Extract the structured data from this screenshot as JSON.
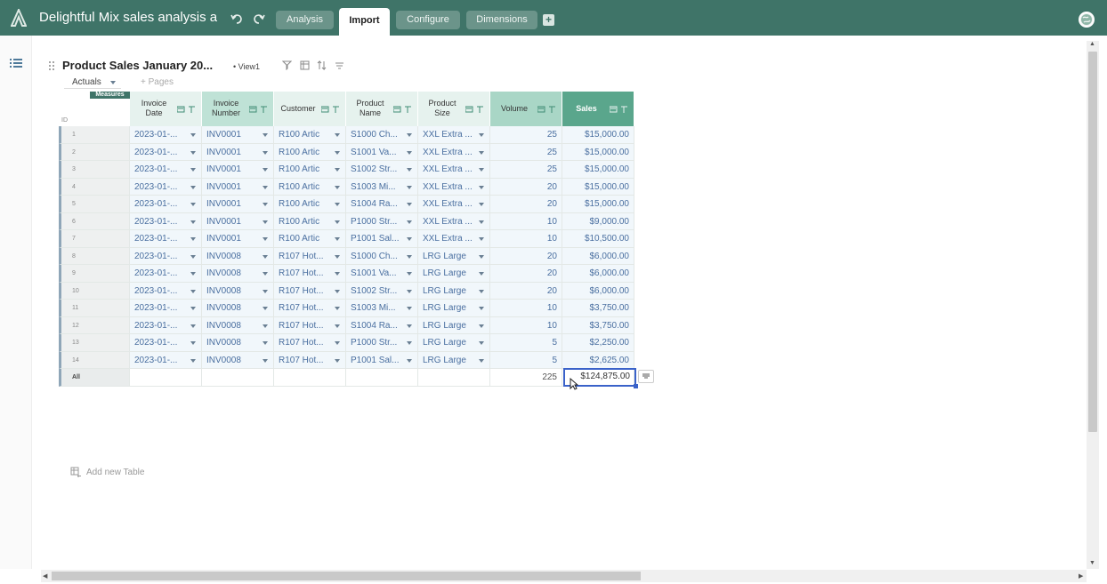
{
  "app": {
    "title": "Delightful Mix sales analysis a",
    "tabs": [
      {
        "label": "Analysis",
        "active": false
      },
      {
        "label": "Import",
        "active": true
      },
      {
        "label": "Configure",
        "active": false
      },
      {
        "label": "Dimensions",
        "active": false
      }
    ],
    "add_tab_label": "+"
  },
  "table": {
    "title": "Product Sales January 20...",
    "view_label": "View1",
    "scenario": "Actuals",
    "pages_label": "+ Pages",
    "measures_badge": "Measures",
    "id_header": "ID",
    "columns": [
      {
        "label_1": "Invoice",
        "label_2": "Date",
        "kind": "attr"
      },
      {
        "label_1": "Invoice",
        "label_2": "Number",
        "kind": "ident"
      },
      {
        "label_1": "Customer",
        "label_2": "",
        "kind": "attr"
      },
      {
        "label_1": "Product",
        "label_2": "Name",
        "kind": "attr"
      },
      {
        "label_1": "Product",
        "label_2": "Size",
        "kind": "attr"
      },
      {
        "label_1": "Volume",
        "label_2": "",
        "kind": "volume"
      },
      {
        "label_1": "Sales",
        "label_2": "",
        "kind": "sales"
      }
    ],
    "rows": [
      {
        "id": "1",
        "date": "2023-01-...",
        "invoice": "INV0001",
        "customer": "R100 Artic",
        "product": "S1000 Ch...",
        "size": "XXL Extra ...",
        "volume": "25",
        "sales": "$15,000.00"
      },
      {
        "id": "2",
        "date": "2023-01-...",
        "invoice": "INV0001",
        "customer": "R100 Artic",
        "product": "S1001 Va...",
        "size": "XXL Extra ...",
        "volume": "25",
        "sales": "$15,000.00"
      },
      {
        "id": "3",
        "date": "2023-01-...",
        "invoice": "INV0001",
        "customer": "R100 Artic",
        "product": "S1002 Str...",
        "size": "XXL Extra ...",
        "volume": "25",
        "sales": "$15,000.00"
      },
      {
        "id": "4",
        "date": "2023-01-...",
        "invoice": "INV0001",
        "customer": "R100 Artic",
        "product": "S1003 Mi...",
        "size": "XXL Extra ...",
        "volume": "20",
        "sales": "$15,000.00"
      },
      {
        "id": "5",
        "date": "2023-01-...",
        "invoice": "INV0001",
        "customer": "R100 Artic",
        "product": "S1004 Ra...",
        "size": "XXL Extra ...",
        "volume": "20",
        "sales": "$15,000.00"
      },
      {
        "id": "6",
        "date": "2023-01-...",
        "invoice": "INV0001",
        "customer": "R100 Artic",
        "product": "P1000 Str...",
        "size": "XXL Extra ...",
        "volume": "10",
        "sales": "$9,000.00"
      },
      {
        "id": "7",
        "date": "2023-01-...",
        "invoice": "INV0001",
        "customer": "R100 Artic",
        "product": "P1001 Sal...",
        "size": "XXL Extra ...",
        "volume": "10",
        "sales": "$10,500.00"
      },
      {
        "id": "8",
        "date": "2023-01-...",
        "invoice": "INV0008",
        "customer": "R107 Hot...",
        "product": "S1000 Ch...",
        "size": "LRG Large",
        "volume": "20",
        "sales": "$6,000.00"
      },
      {
        "id": "9",
        "date": "2023-01-...",
        "invoice": "INV0008",
        "customer": "R107 Hot...",
        "product": "S1001 Va...",
        "size": "LRG Large",
        "volume": "20",
        "sales": "$6,000.00"
      },
      {
        "id": "10",
        "date": "2023-01-...",
        "invoice": "INV0008",
        "customer": "R107 Hot...",
        "product": "S1002 Str...",
        "size": "LRG Large",
        "volume": "20",
        "sales": "$6,000.00"
      },
      {
        "id": "11",
        "date": "2023-01-...",
        "invoice": "INV0008",
        "customer": "R107 Hot...",
        "product": "S1003 Mi...",
        "size": "LRG Large",
        "volume": "10",
        "sales": "$3,750.00"
      },
      {
        "id": "12",
        "date": "2023-01-...",
        "invoice": "INV0008",
        "customer": "R107 Hot...",
        "product": "S1004 Ra...",
        "size": "LRG Large",
        "volume": "10",
        "sales": "$3,750.00"
      },
      {
        "id": "13",
        "date": "2023-01-...",
        "invoice": "INV0008",
        "customer": "R107 Hot...",
        "product": "P1000 Str...",
        "size": "LRG Large",
        "volume": "5",
        "sales": "$2,250.00"
      },
      {
        "id": "14",
        "date": "2023-01-...",
        "invoice": "INV0008",
        "customer": "R107 Hot...",
        "product": "P1001 Sal...",
        "size": "LRG Large",
        "volume": "5",
        "sales": "$2,625.00"
      }
    ],
    "total": {
      "label": "All",
      "volume": "225",
      "sales": "$124,875.00"
    },
    "add_table_label": "Add new Table"
  },
  "colors": {
    "topbar": "#3f7468",
    "sales_header": "#5aa68c",
    "volume_header": "#a9d6c6",
    "selection": "#3a62c9"
  },
  "icons": [
    "logo-icon",
    "undo-icon",
    "redo-icon",
    "add-tab-icon",
    "avatar",
    "list-icon",
    "filter-icon",
    "sort-icon",
    "chevron-down-icon",
    "cell-menu-icon",
    "cursor-icon",
    "add-table-icon"
  ]
}
